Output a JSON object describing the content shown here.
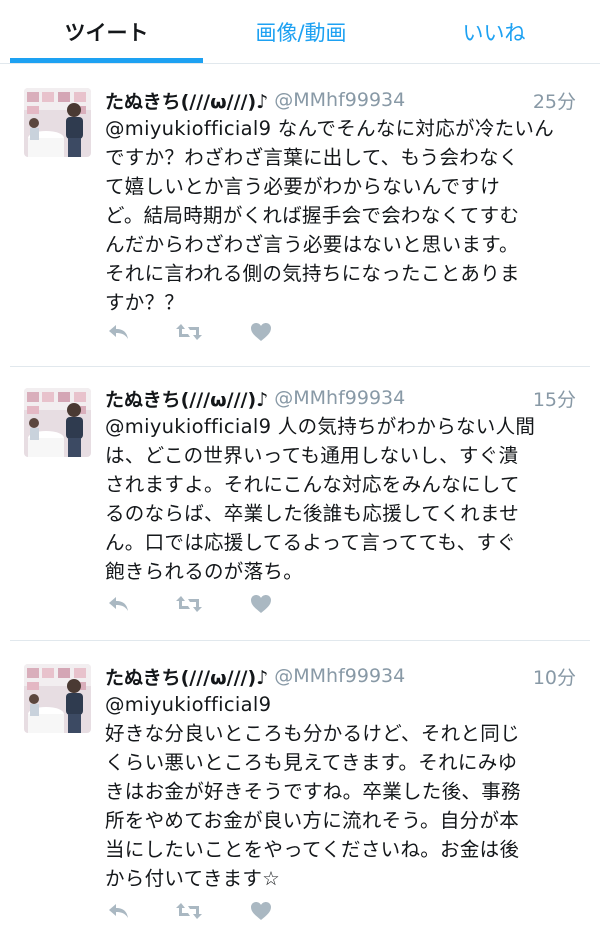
{
  "tabs": [
    {
      "label": "ツイート",
      "active": true
    },
    {
      "label": "画像/動画",
      "active": false
    },
    {
      "label": "いいね",
      "active": false
    }
  ],
  "colors": {
    "accent": "#1da1f2",
    "muted": "#8899a6",
    "text": "#14171a",
    "icon": "#aab8c2"
  },
  "tweets": [
    {
      "name": "たぬきち(///ω///)♪",
      "handle": "@MMhf99934",
      "time": "25分",
      "text": "@miyukiofficial9 なんでそんなに対応が冷たいん\nですか？わざわざ言葉に出して、もう会わなく\nて嬉しいとか言う必要がわからないんですけ\nど。結局時期がくれば握手会で会わなくてすむ\nんだからわざわざ言う必要はないと思います。\nそれに言われる側の気持ちになったことありま\nすか？？",
      "icons": [
        "reply-icon",
        "retweet-icon",
        "heart-icon"
      ]
    },
    {
      "name": "たぬきち(///ω///)♪",
      "handle": "@MMhf99934",
      "time": "15分",
      "text": "@miyukiofficial9 人の気持ちがわからない人間\nは、どこの世界いっても通用しないし、すぐ潰\nされますよ。それにこんな対応をみんなにして\nるのならば、卒業した後誰も応援してくれませ\nん。口では応援してるよって言ってても、すぐ\n飽きられるのが落ち。",
      "icons": [
        "reply-icon",
        "retweet-icon",
        "heart-icon"
      ]
    },
    {
      "name": "たぬきち(///ω///)♪",
      "handle": "@MMhf99934",
      "time": "10分",
      "text": "@miyukiofficial9\n好きな分良いところも分かるけど、それと同じ\nくらい悪いところも見えてきます。それにみゆ\nきはお金が好きそうですね。卒業した後、事務\n所をやめてお金が良い方に流れそう。自分が本\n当にしたいことをやってくださいね。お金は後\nから付いてきます☆",
      "icons": [
        "reply-icon",
        "retweet-icon",
        "heart-icon"
      ]
    }
  ]
}
